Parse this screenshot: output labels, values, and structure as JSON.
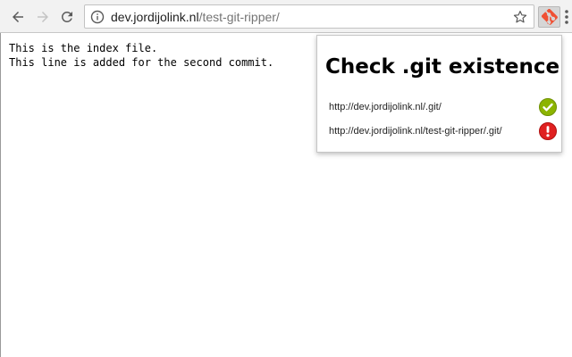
{
  "browser": {
    "url_host": "dev.jordijolink.nl",
    "url_path": "/test-git-ripper/"
  },
  "page": {
    "lines": [
      "This is the index file.",
      "This line is added for the second commit."
    ]
  },
  "popup": {
    "title": "Check .git existence",
    "results": [
      {
        "url": "http://dev.jordijolink.nl/.git/",
        "status": "found",
        "icon": "check-circle-icon",
        "color": "#8cb400"
      },
      {
        "url": "http://dev.jordijolink.nl/test-git-ripper/.git/",
        "status": "not-found",
        "icon": "error-circle-icon",
        "color": "#e02020"
      }
    ]
  },
  "colors": {
    "extension_accent": "#f05033"
  }
}
